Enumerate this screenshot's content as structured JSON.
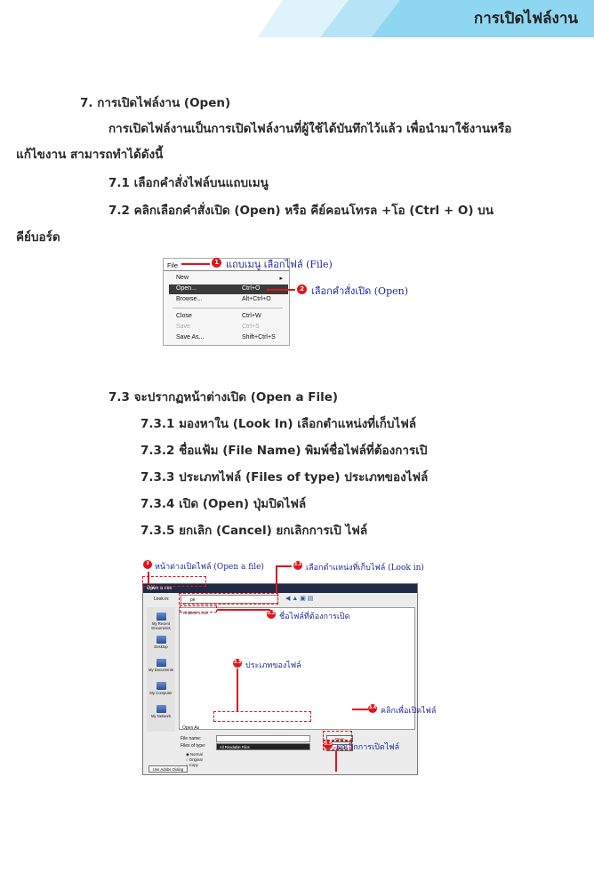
{
  "header": {
    "title": "การเปิดไฟล์งาน",
    "colors": {
      "band_light": "#d9f1fb",
      "band_main": "#8fd7f1"
    }
  },
  "body": {
    "heading": "7. การเปิดไฟล์งาน (Open)",
    "para_line1": "การเปิดไฟล์งานเป็นการเปิดไฟล์งานที่ผู้ใช้ได้บันทึกไว้แล้ว เพื่อนำมาใช้งานหรือ",
    "para_line2": "แก้ไขงาน สามารถทำได้ดังนี้",
    "step_7_1": "7.1 เลือกคำสั่งไฟล์บนแถบเมนู",
    "step_7_2_line1": "7.2 คลิกเลือกคำสั่งเปิด (Open) หรือ คีย์คอนโทรล +โอ (Ctrl + O) บน",
    "step_7_2_line2": "คีย์บอร์ด",
    "step_7_3": "7.3 จะปรากฏหน้าต่างเปิด (Open a File)",
    "step_7_3_1": "7.3.1 มองหาใน (Look In) เลือกตำแหน่งที่เก็บไฟล์",
    "step_7_3_2": "7.3.2 ชื่อแฟ้ม (File Name) พิมพ์ชื่อไฟล์ที่ต้องการเปิ",
    "step_7_3_3": "7.3.3 ประเภทไฟล์ (Files of type) ประเภทของไฟล์",
    "step_7_3_4": "7.3.4 เปิด (Open) ปุ่มปิดไฟล์",
    "step_7_3_5": "7.3.5 ยกเลิก (Cancel) ยกเลิกการเปิ ไฟล์"
  },
  "menu_shot": {
    "menubar_label": "File",
    "items": [
      {
        "label": "New",
        "shortcut": ""
      },
      {
        "label": "Open...",
        "shortcut": "Ctrl+O"
      },
      {
        "label": "Browse...",
        "shortcut": "Alt+Ctrl+O"
      },
      {
        "label": "Close",
        "shortcut": "Ctrl+W"
      },
      {
        "label": "Save",
        "shortcut": "Ctrl+S"
      },
      {
        "label": "Save As...",
        "shortcut": "Shift+Ctrl+S"
      }
    ],
    "annotation_1": "แถบเมนู เลือกไฟล์ (File)",
    "annotation_2": "เลือกคำสั่งเปิด (Open)",
    "badge_1": "1",
    "badge_2": "2"
  },
  "dialog_shot": {
    "title": "Open a File",
    "window_controls": "? X",
    "lookin_label": "Look in:",
    "lookin_value": "pe",
    "file_item": "Untitled-1.indt",
    "places": [
      "My Recent Documents",
      "Desktop",
      "My Documents",
      "My Computer",
      "My Network"
    ],
    "file_name_label": "File name:",
    "files_of_type_label": "Files of type:",
    "files_of_type_value": "All Readable Files",
    "open_button": "Open",
    "cancel_button": "Cancel",
    "open_as_label": "Open As",
    "open_as_options": [
      "Normal",
      "Original",
      "Copy"
    ],
    "adobe_dialog_button": "Use Adobe Dialog",
    "annotations": {
      "window": "หน้าต่างเปิดไฟล์ (Open a file)",
      "lookin": "เลือกตำแหน่งที่เก็บไฟล์ (Look in)",
      "filename": "ชื่อไฟล์ที่ต้องการเปิด",
      "filetype": "ประเภทของไฟล์",
      "open": "คลิกเพื่อเปิดไฟล์",
      "cancel": "ยกเลิกการเปิดไฟล์"
    },
    "badges": {
      "window": "3",
      "lookin": "3.1",
      "filename": "3.2",
      "filetype": "3.3",
      "open": "3.4",
      "cancel": "3.5"
    }
  }
}
